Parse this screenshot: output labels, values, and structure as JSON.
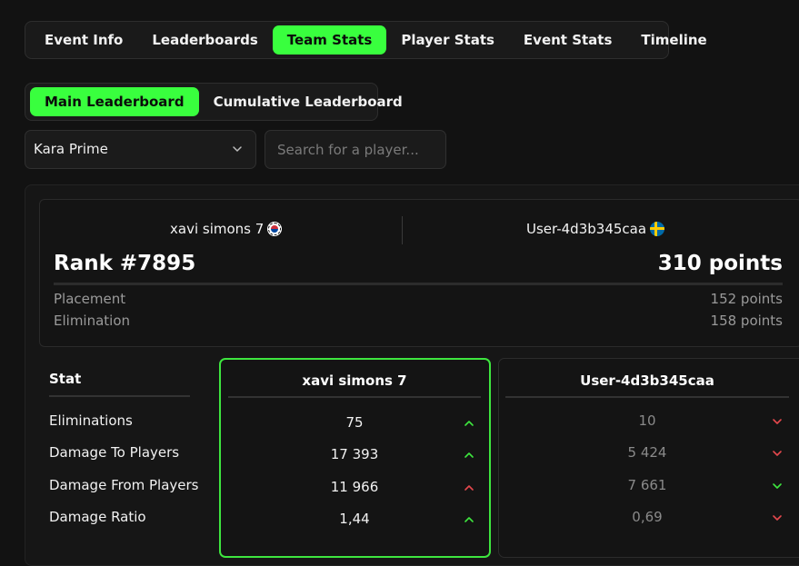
{
  "tabs": [
    "Event Info",
    "Leaderboards",
    "Team Stats",
    "Player Stats",
    "Event Stats",
    "Timeline"
  ],
  "active_tab": "Team Stats",
  "subtabs": [
    "Main Leaderboard",
    "Cumulative Leaderboard"
  ],
  "active_subtab": "Main Leaderboard",
  "region_select": {
    "value": "Kara Prime"
  },
  "search": {
    "placeholder": "Search for a player..."
  },
  "summary": {
    "player1": "xavi simons 7",
    "player1_flag": "south-korea-flag-icon",
    "player2": "User-4d3b345caa",
    "player2_flag": "sweden-flag-icon",
    "rank": "Rank #7895",
    "total_points": "310 points",
    "breakdown": [
      {
        "label": "Placement",
        "value": "152 points"
      },
      {
        "label": "Elimination",
        "value": "158 points"
      }
    ]
  },
  "stats_table": {
    "stat_header": "Stat",
    "player1_header": "xavi simons 7",
    "player2_header": "User-4d3b345caa",
    "rows": [
      {
        "stat": "Eliminations",
        "p1": "75",
        "p1_trend": "up",
        "p2": "10",
        "p2_trend": "down"
      },
      {
        "stat": "Damage To Players",
        "p1": "17 393",
        "p1_trend": "up",
        "p2": "5 424",
        "p2_trend": "down"
      },
      {
        "stat": "Damage From Players",
        "p1": "11 966",
        "p1_trend": "up-red",
        "p2": "7 661",
        "p2_trend": "down-green"
      },
      {
        "stat": "Damage Ratio",
        "p1": "1,44",
        "p1_trend": "up",
        "p2": "0,69",
        "p2_trend": "down"
      }
    ]
  },
  "colors": {
    "accent": "#39ff3e",
    "up": "#3ee63f",
    "down": "#e5484d"
  }
}
